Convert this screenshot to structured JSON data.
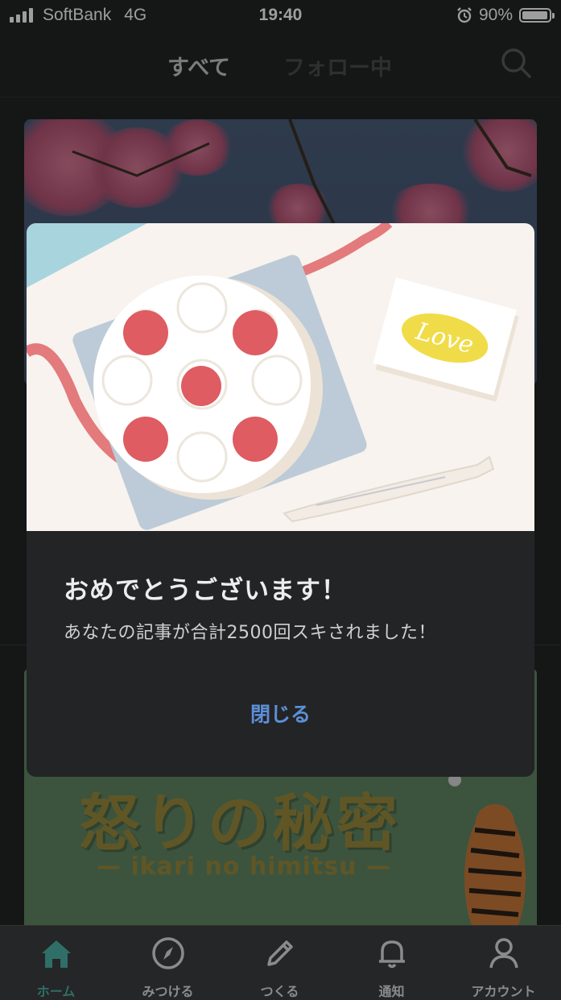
{
  "status_bar": {
    "carrier": "SoftBank",
    "network": "4G",
    "time": "19:40",
    "battery": "90%",
    "battery_level": 0.9
  },
  "header": {
    "tabs": [
      {
        "label": "すべて",
        "active": true
      },
      {
        "label": "フォロー中",
        "active": false
      }
    ]
  },
  "feed": {
    "card2_title": "怒りの秘密",
    "card2_subtitle": "— ikari no himitsu —"
  },
  "modal": {
    "illustration_text": "Love",
    "title": "おめでとうございます！",
    "message": "あなたの記事が合計2500回スキされました！",
    "close_label": "閉じる"
  },
  "bottom_nav": {
    "items": [
      {
        "label": "ホーム",
        "icon": "home-icon",
        "active": true
      },
      {
        "label": "みつける",
        "icon": "compass-icon",
        "active": false
      },
      {
        "label": "つくる",
        "icon": "pencil-icon",
        "active": false
      },
      {
        "label": "通知",
        "icon": "bell-icon",
        "active": false
      },
      {
        "label": "アカウント",
        "icon": "person-icon",
        "active": false
      }
    ]
  },
  "colors": {
    "accent_green": "#2f6f67",
    "link_blue": "#5c8fd9",
    "background": "#232425"
  }
}
